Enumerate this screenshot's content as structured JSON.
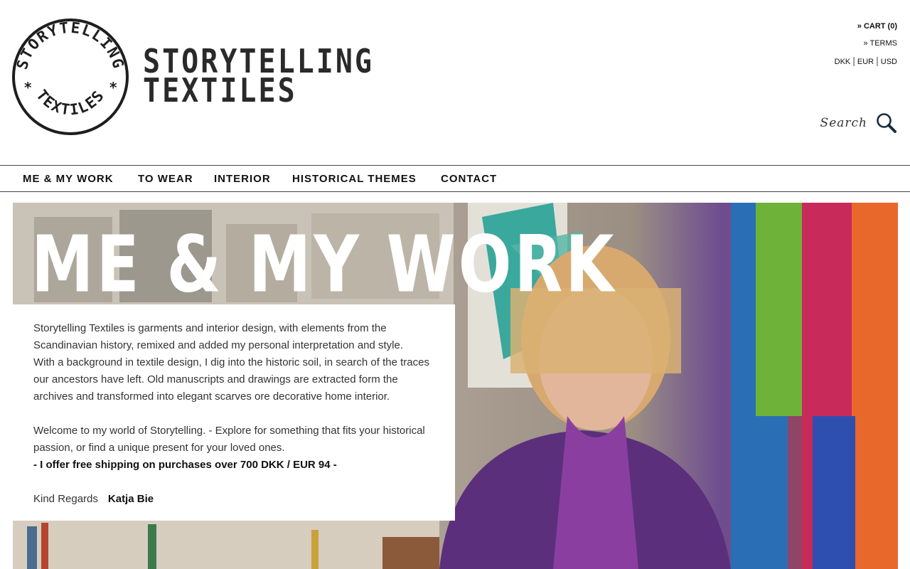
{
  "brand": {
    "stamp_top": "STORYTELLING",
    "stamp_bottom": "TEXTILES",
    "word_line1": "STORYTELLING",
    "word_line2": "TEXTILES"
  },
  "util": {
    "cart": "» CART (0)",
    "terms": "» TERMS",
    "currencies": [
      "DKK",
      "EUR",
      "USD"
    ],
    "separator": "|"
  },
  "search": {
    "placeholder": "Search",
    "icon": "search-icon"
  },
  "nav": [
    "ME & MY WORK",
    "TO WEAR",
    "INTERIOR",
    "HISTORICAL THEMES",
    "CONTACT"
  ],
  "hero": {
    "title": "ME & MY WORK"
  },
  "intro": {
    "p1": "Storytelling Textiles is garments and interior design, with elements from the Scandinavian history, remixed and added my personal interpretation and style.",
    "p2": "With a background in textile design, I dig into the historic soil, in search of the traces our ancestors have left. Old manuscripts and drawings are extracted form the archives and transformed into elegant scarves ore decorative home interior.",
    "p3": "Welcome to my world of Storytelling.  - Explore for something that fits your historical passion, or find a unique present for your loved ones.",
    "shipping": "-  I offer free shipping on purchases over 700 DKK  /  EUR 94  -",
    "regards": "Kind Regards",
    "name": "Katja Bie"
  }
}
